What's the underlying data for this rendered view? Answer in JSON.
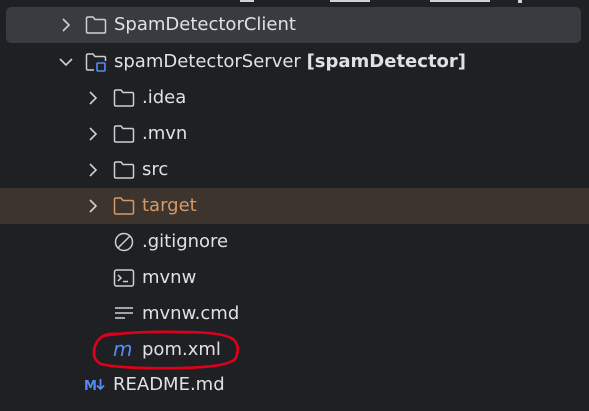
{
  "colors": {
    "background": "#1f2023",
    "text": "#dfe1e5",
    "selected_row": "#393b40",
    "excluded_row": "#3d342e",
    "excluded_text": "#d49a6a",
    "icon_gray": "#ced0d6",
    "maven_blue": "#548af7",
    "annotation_red": "#e0001b"
  },
  "tree": {
    "items": [
      {
        "label": "SpamDetectorClient",
        "icon": "folder-icon",
        "state": "collapsed"
      },
      {
        "label": "spamDetectorServer",
        "module": "[spamDetector]",
        "icon": "module-folder-icon",
        "state": "expanded"
      },
      {
        "label": ".idea",
        "icon": "folder-icon",
        "state": "collapsed"
      },
      {
        "label": ".mvn",
        "icon": "folder-icon",
        "state": "collapsed"
      },
      {
        "label": "src",
        "icon": "folder-icon",
        "state": "collapsed"
      },
      {
        "label": "target",
        "icon": "excluded-folder-icon",
        "state": "collapsed"
      },
      {
        "label": ".gitignore",
        "icon": "ignore-file-icon"
      },
      {
        "label": "mvnw",
        "icon": "terminal-script-icon"
      },
      {
        "label": "mvnw.cmd",
        "icon": "text-file-icon"
      },
      {
        "label": "pom.xml",
        "icon": "maven-file-icon"
      },
      {
        "label": "README.md",
        "icon": "markdown-file-icon"
      }
    ]
  }
}
